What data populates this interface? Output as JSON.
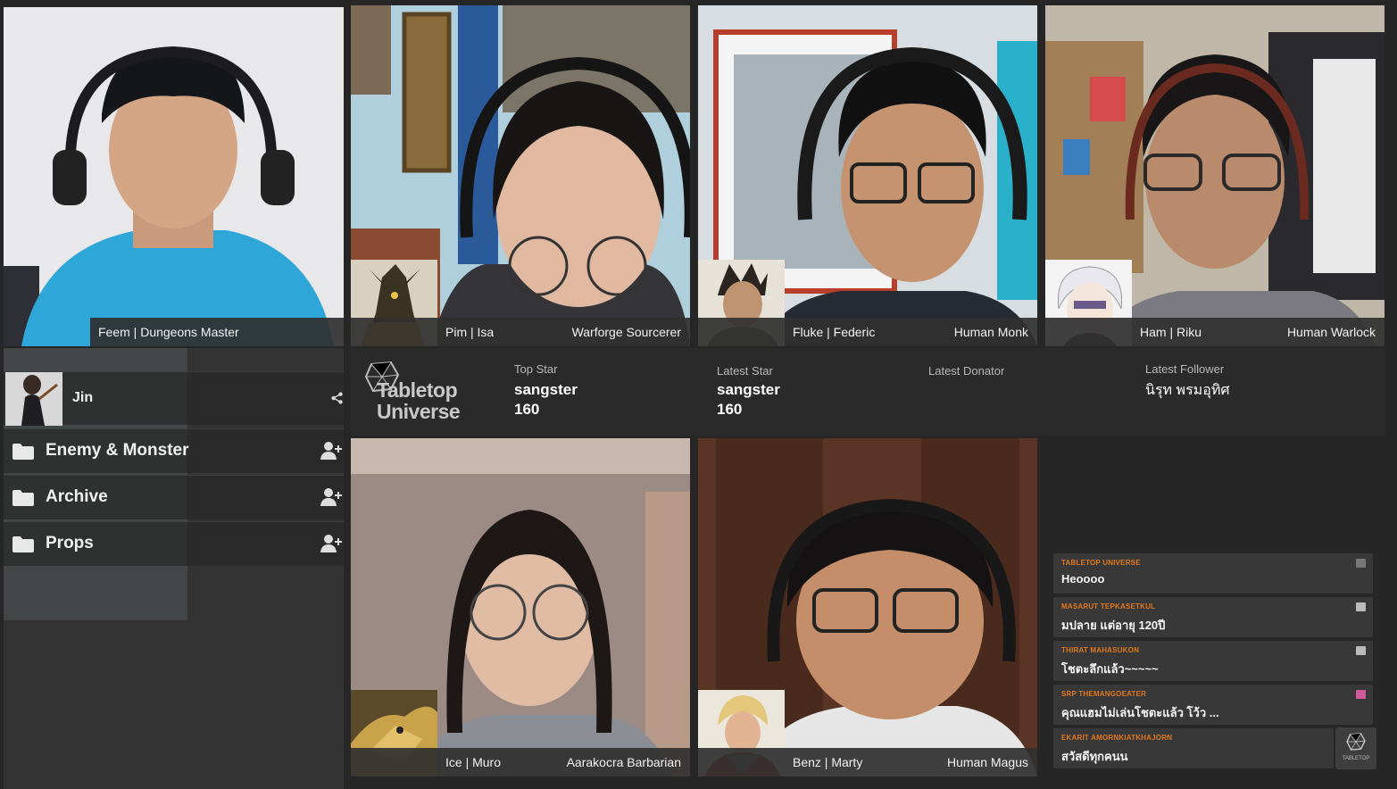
{
  "participants": [
    {
      "name": "Feem | Dungeons Master",
      "class": ""
    },
    {
      "name": "Pim | Isa",
      "class": "Warforge Sourcerer"
    },
    {
      "name": "Fluke | Federic",
      "class": "Human Monk"
    },
    {
      "name": "Ham | Riku",
      "class": "Human Warlock"
    },
    {
      "name": "Ice | Muro",
      "class": "Aarakocra Barbarian"
    },
    {
      "name": "Benz | Marty",
      "class": "Human Magus"
    }
  ],
  "sidebar": {
    "user_name": "Jin",
    "folders": [
      {
        "label": "Enemy & Monster"
      },
      {
        "label": "Archive"
      },
      {
        "label": "Props"
      }
    ]
  },
  "brand": {
    "line1": "Tabletop",
    "line2": "Universe"
  },
  "stats": {
    "top_star": {
      "title": "Top Star",
      "name": "sangster",
      "value": "160"
    },
    "latest_star": {
      "title": "Latest Star",
      "name": "sangster",
      "value": "160"
    },
    "latest_donator": {
      "title": "Latest Donator"
    },
    "latest_follower": {
      "title": "Latest Follower",
      "name": "นิรุท พรมอุทิศ"
    }
  },
  "chat": [
    {
      "user": "TABLETOP UNIVERSE",
      "message": "Heoooo"
    },
    {
      "user": "MASARUT TEPKASETKUL",
      "message": "มปลาย แต่อายุ 120ปี"
    },
    {
      "user": "THIRAT MAHASUKON",
      "message": "โชตะลึกแล้ว~~~~~"
    },
    {
      "user": "SRP THEMANGOEATER",
      "message": "คุณแฮมไม่เล่นโชตะแล้ว โว้ว ..."
    },
    {
      "user": "EKARIT AMORNKIATKHAJORN",
      "message": "สวัสดีทุกคนน"
    }
  ],
  "chat_badge": "TABLETOP",
  "colors": {
    "background": "#262626",
    "nameplate": "#303030",
    "chat_bg": "#383838",
    "chat_name": "#e0791c"
  },
  "icons": [
    "share-icon",
    "folder-icon",
    "add-user-icon",
    "chat-badge-icon"
  ]
}
